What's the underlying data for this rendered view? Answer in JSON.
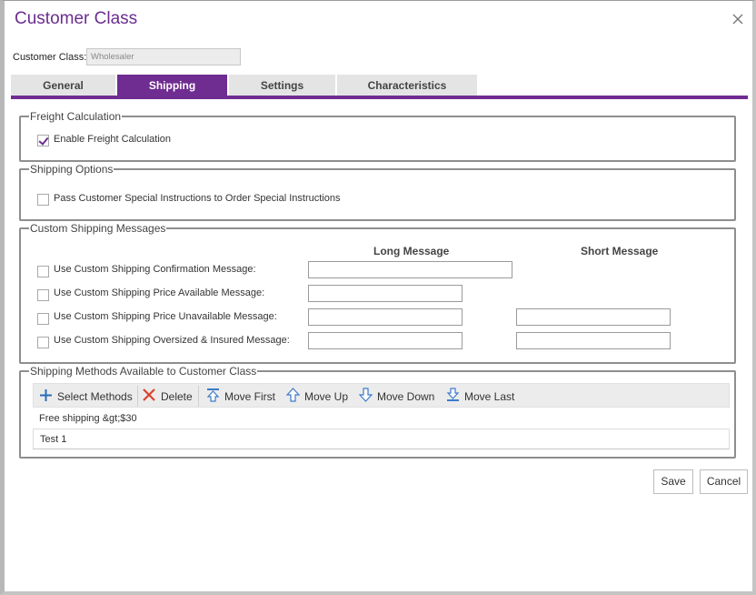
{
  "dialog": {
    "title": "Customer Class"
  },
  "customer_class": {
    "label": "Customer Class:",
    "value": "Wholesaler"
  },
  "tabs": [
    {
      "label": "General",
      "active": false
    },
    {
      "label": "Shipping",
      "active": true
    },
    {
      "label": "Settings",
      "active": false
    },
    {
      "label": "Characteristics",
      "active": false
    }
  ],
  "freight": {
    "legend": "Freight Calculation",
    "enable_label": "Enable Freight Calculation",
    "enable_checked": true
  },
  "shipping_options": {
    "legend": "Shipping Options",
    "pass_label": "Pass Customer Special Instructions to Order Special Instructions",
    "pass_checked": false
  },
  "custom_messages": {
    "legend": "Custom Shipping Messages",
    "long_header": "Long Message",
    "short_header": "Short Message",
    "rows": [
      {
        "label": "Use Custom Shipping Confirmation Message:",
        "checked": false,
        "long": "",
        "short": null
      },
      {
        "label": "Use Custom Shipping Price Available Message:",
        "checked": false,
        "long": "",
        "short": null
      },
      {
        "label": "Use Custom Shipping Price Unavailable Message:",
        "checked": false,
        "long": "",
        "short": ""
      },
      {
        "label": "Use Custom Shipping Oversized & Insured Message:",
        "checked": false,
        "long": "",
        "short": ""
      }
    ]
  },
  "methods": {
    "legend": "Shipping Methods Available to Customer Class",
    "toolbar": {
      "select": "Select Methods",
      "delete": "Delete",
      "move_first": "Move First",
      "move_up": "Move Up",
      "move_down": "Move Down",
      "move_last": "Move Last"
    },
    "items": [
      "Free shipping &gt;$30",
      "Test 1"
    ]
  },
  "footer": {
    "save": "Save",
    "cancel": "Cancel"
  },
  "colors": {
    "accent": "#6f2c91",
    "title": "#6b2d8f",
    "delete_icon": "#d9432b",
    "move_icon": "#3b7bc8",
    "add_icon": "#2a6db5"
  }
}
